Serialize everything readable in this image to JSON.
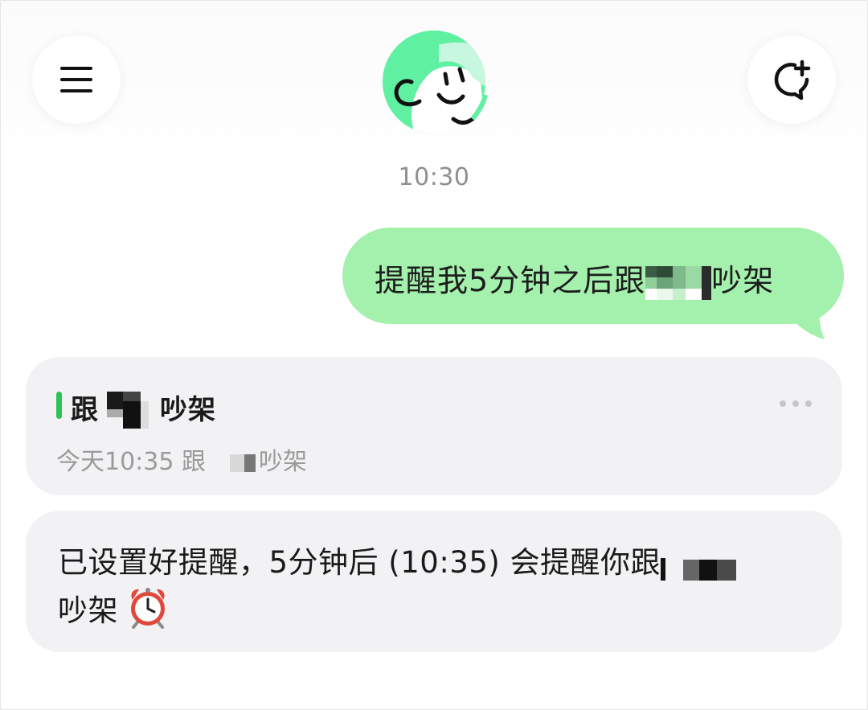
{
  "header": {
    "menu_icon": "hamburger-menu-icon",
    "new_chat_icon": "new-chat-plus-icon",
    "avatar_icon": "smiling-face-avatar",
    "brand_color": "#5ff0a2"
  },
  "chat": {
    "timestamp": "10:30",
    "user_message": {
      "text_before": "提醒我5分钟之后跟",
      "text_after": "吵架",
      "bubble_color": "#a4f0ad"
    },
    "reminder_card": {
      "title_before": "跟",
      "title_after": "吵架",
      "detail_before": "今天10:35 跟",
      "detail_after": "吵架",
      "accent_color": "#2cc255"
    },
    "assistant_reply": {
      "line1": "已设置好提醒，5分钟后 (10:35) 会提醒你跟",
      "line2": "吵架",
      "emoji_icon": "alarm-clock-icon"
    }
  }
}
